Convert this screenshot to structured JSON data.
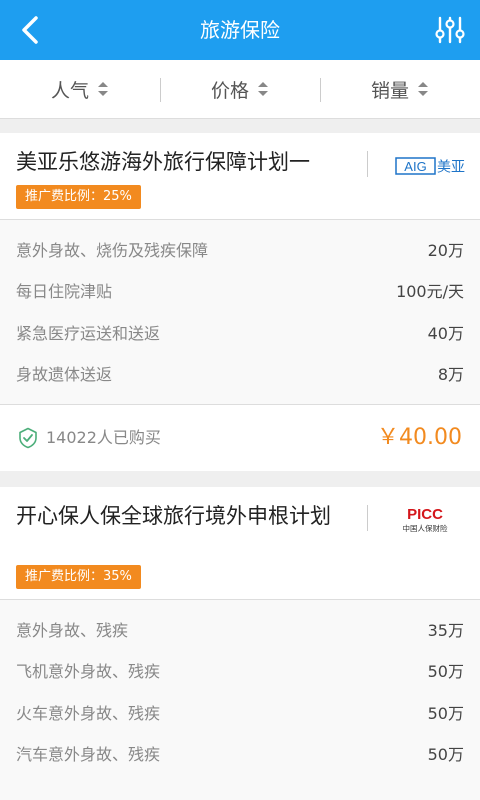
{
  "header": {
    "title": "旅游保险"
  },
  "sort": {
    "items": [
      "人气",
      "价格",
      "销量"
    ]
  },
  "products": [
    {
      "name": "美亚乐悠游海外旅行保障计划一",
      "logo_text": "美亚",
      "logo_brand": "AIG",
      "badge": "推广费比例：25%",
      "coverages": [
        {
          "label": "意外身故、烧伤及残疾保障",
          "value": "20万"
        },
        {
          "label": "每日住院津贴",
          "value": "100元/天"
        },
        {
          "label": "紧急医疗运送和送返",
          "value": "40万"
        },
        {
          "label": "身故遗体送返",
          "value": "8万"
        }
      ],
      "buyers": "14022人已购买",
      "price": "￥40.00"
    },
    {
      "name": "开心保人保全球旅行境外申根计划",
      "logo_brand": "PICC",
      "logo_text": "中国人保财险",
      "badge": "推广费比例：35%",
      "coverages": [
        {
          "label": "意外身故、残疾",
          "value": "35万"
        },
        {
          "label": "飞机意外身故、残疾",
          "value": "50万"
        },
        {
          "label": "火车意外身故、残疾",
          "value": "50万"
        },
        {
          "label": "汽车意外身故、残疾",
          "value": "50万"
        }
      ]
    }
  ],
  "colors": {
    "header": "#1e9ef0",
    "accent": "#f28a1f",
    "aig": "#1e74c8",
    "picc": "#d4161b"
  }
}
